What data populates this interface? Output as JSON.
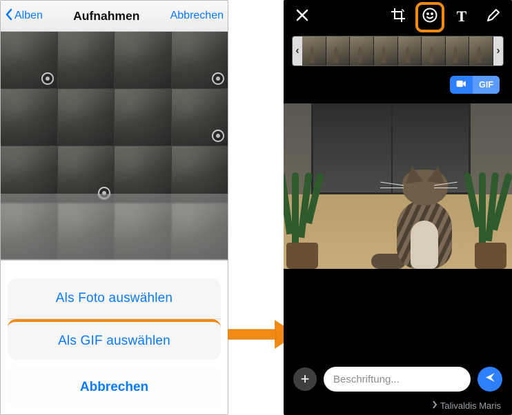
{
  "left": {
    "header": {
      "back_label": "Alben",
      "title": "Aufnahmen",
      "cancel_label": "Abbrechen"
    },
    "action_sheet": {
      "option_photo": "Als Foto auswählen",
      "option_gif": "Als GIF auswählen",
      "cancel": "Abbrechen"
    }
  },
  "right": {
    "toggle": {
      "gif_label": "GIF"
    },
    "compose": {
      "caption_placeholder": "Beschriftung..."
    },
    "recipient": {
      "name": "Talivaldis Maris"
    }
  },
  "colors": {
    "ios_blue": "#0a7aff",
    "send_blue": "#2f80ff",
    "highlight_orange": "#f08a15"
  }
}
